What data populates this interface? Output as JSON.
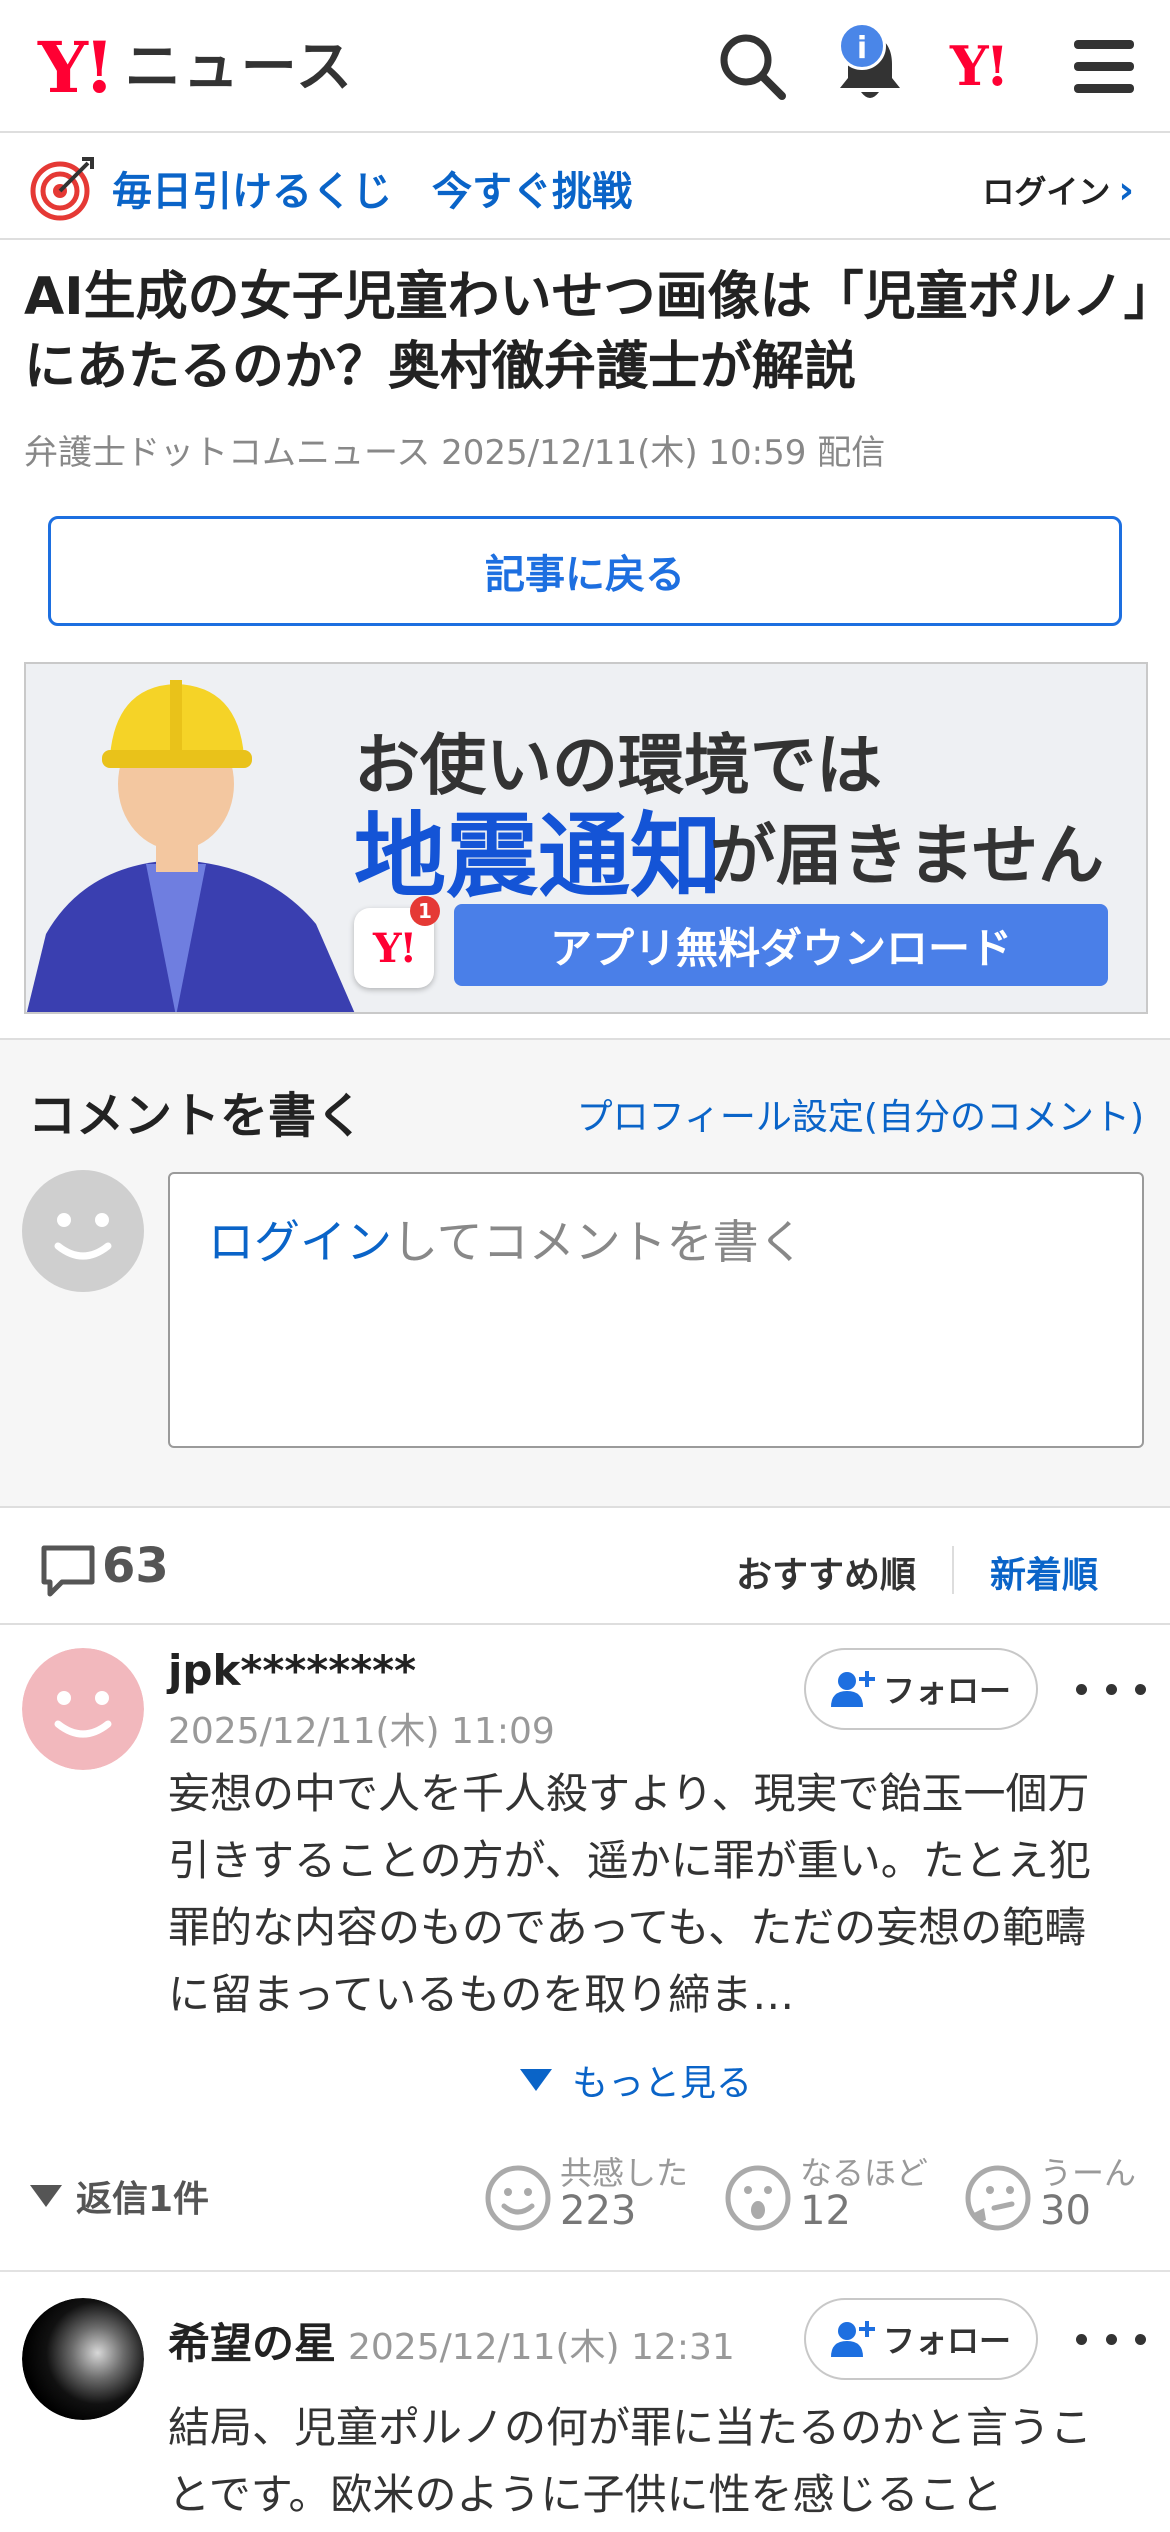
{
  "header": {
    "logo_y": "Y!",
    "logo_text": "ニュース",
    "notif_badge": "i",
    "yahoo_mark": "Y!"
  },
  "lottery": {
    "text": "毎日引けるくじ　今すぐ挑戦",
    "login": "ログイン",
    "login_chevron": "›"
  },
  "article": {
    "title": "AI生成の女子児童わいせつ画像は「児童ポルノ」にあたるのか？奥村徹弁護士が解説",
    "source": "弁護士ドットコムニュース 2025/12/11(木) 10:59 配信",
    "back_button": "記事に戻る"
  },
  "banner": {
    "line1": "お使いの環境では",
    "line2_highlight": "地震通知",
    "line2_rest": "が届きません",
    "app_badge": "1",
    "app_logo": "Y!",
    "button": "アプリ無料ダウンロード"
  },
  "comment_form": {
    "heading": "コメントを書く",
    "profile_link": "プロフィール設定(自分のコメント)",
    "login_link": "ログイン",
    "placeholder_rest": "してコメントを書く"
  },
  "sort": {
    "count": "63",
    "recommended": "おすすめ順",
    "newest": "新着順"
  },
  "comments": [
    {
      "user": "jpk********",
      "date": "2025/12/11(木) 11:09",
      "follow": "フォロー",
      "body": "妄想の中で人を千人殺すより、現実で飴玉一個万引きすることの方が、遥かに罪が重い。たとえ犯罪的な内容のものであっても、ただの妄想の範疇に留まっているものを取り締ま…",
      "see_more": "もっと見る",
      "replies": "返信1件",
      "reactions": [
        {
          "label": "共感した",
          "count": "223",
          "icon": "smile-icon"
        },
        {
          "label": "なるほど",
          "count": "12",
          "icon": "surprised-icon"
        },
        {
          "label": "うーん",
          "count": "30",
          "icon": "thinking-icon"
        }
      ]
    },
    {
      "user": "希望の星",
      "date": "2025/12/11(木) 12:31",
      "follow": "フォロー",
      "body": "結局、児童ポルノの何が罪に当たるのかと言うことです。欧米のように子供に性を感じること"
    }
  ],
  "colors": {
    "brand_red": "#ff0033",
    "link_blue": "#0a64c8",
    "banner_blue": "#4a7fe8"
  }
}
